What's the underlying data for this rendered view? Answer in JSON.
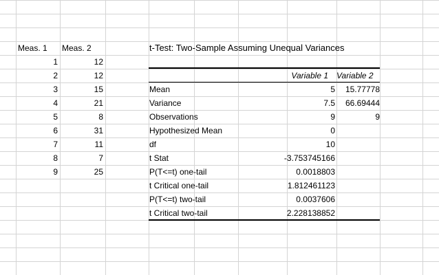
{
  "sheet": {
    "col_a_header": "Meas. 1",
    "col_b_header": "Meas. 2",
    "meas1": [
      "1",
      "2",
      "3",
      "4",
      "5",
      "6",
      "7",
      "8",
      "9"
    ],
    "meas2": [
      "12",
      "12",
      "15",
      "21",
      "8",
      "31",
      "11",
      "7",
      "25"
    ]
  },
  "ttest": {
    "title": "t-Test: Two-Sample Assuming Unequal Variances",
    "var1_header": "Variable 1",
    "var2_header": "Variable 2",
    "rows": [
      {
        "label": "Mean",
        "v1": "5",
        "v2": "15.77778"
      },
      {
        "label": "Variance",
        "v1": "7.5",
        "v2": "66.69444"
      },
      {
        "label": "Observations",
        "v1": "9",
        "v2": "9"
      },
      {
        "label": "Hypothesized Mean",
        "v1": "0",
        "v2": ""
      },
      {
        "label": "df",
        "v1": "10",
        "v2": ""
      },
      {
        "label": "t Stat",
        "v1": "-3.753745166",
        "v2": ""
      },
      {
        "label": "P(T<=t) one-tail",
        "v1": "0.0018803",
        "v2": ""
      },
      {
        "label": "t Critical one-tail",
        "v1": "1.812461123",
        "v2": ""
      },
      {
        "label": "P(T<=t) two-tail",
        "v1": "0.0037606",
        "v2": ""
      },
      {
        "label": "t Critical two-tail",
        "v1": "2.228138852",
        "v2": ""
      }
    ]
  }
}
